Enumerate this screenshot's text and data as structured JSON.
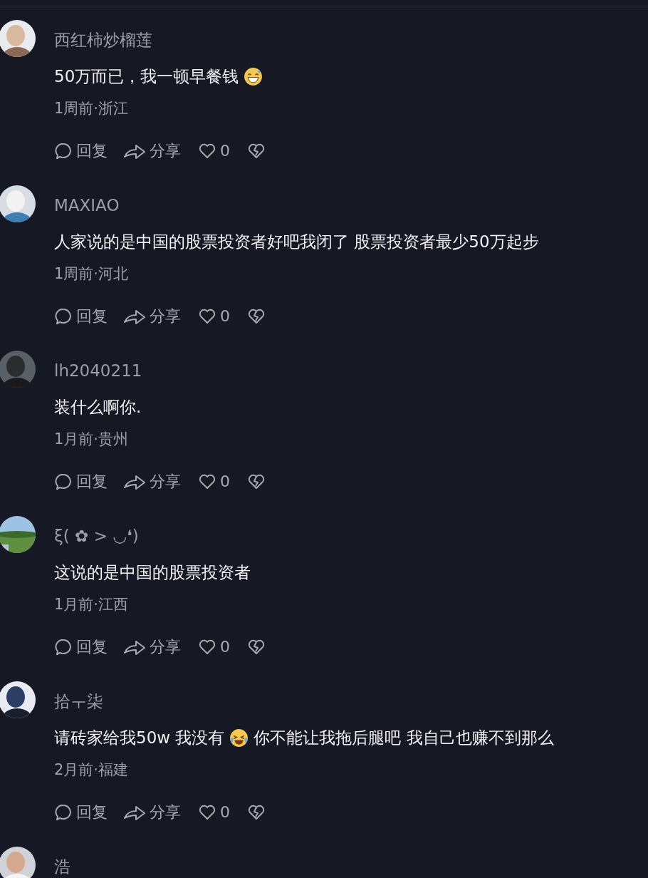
{
  "comments": [
    {
      "user": "西红柿炒榴莲",
      "content": [
        {
          "kind": "text",
          "text": "50万而已，我一顿早餐钱"
        },
        {
          "kind": "sweat-emoji"
        }
      ],
      "meta": "1周前·浙江",
      "actions": {
        "reply": "回复",
        "share": "分享",
        "likes": "0"
      }
    },
    {
      "user": "MAXIAO",
      "content": [
        {
          "kind": "text",
          "text": "人家说的是中国的股票投资者好吧我闭了 股票投资者最少50万起步"
        }
      ],
      "meta": "1周前·河北",
      "actions": {
        "reply": "回复",
        "share": "分享",
        "likes": "0"
      }
    },
    {
      "user": "lh2040211",
      "content": [
        {
          "kind": "text",
          "text": "装什么啊你."
        }
      ],
      "meta": "1月前·贵州",
      "actions": {
        "reply": "回复",
        "share": "分享",
        "likes": "0"
      }
    },
    {
      "user": "ξ( ✿ > ◡❛)",
      "content": [
        {
          "kind": "text",
          "text": "这说的是中国的股票投资者"
        }
      ],
      "meta": "1月前·江西",
      "actions": {
        "reply": "回复",
        "share": "分享",
        "likes": "0"
      }
    },
    {
      "user": "拾ㅜ柒",
      "content": [
        {
          "kind": "text",
          "text": "请砖家给我50w 我没有"
        },
        {
          "kind": "tears-emoji"
        },
        {
          "kind": "text",
          "text": "你不能让我拖后腿吧 我自己也赚不到那么"
        }
      ],
      "meta": "2月前·福建",
      "actions": {
        "reply": "回复",
        "share": "分享",
        "likes": "0"
      }
    },
    {
      "user": "浩"
    }
  ]
}
